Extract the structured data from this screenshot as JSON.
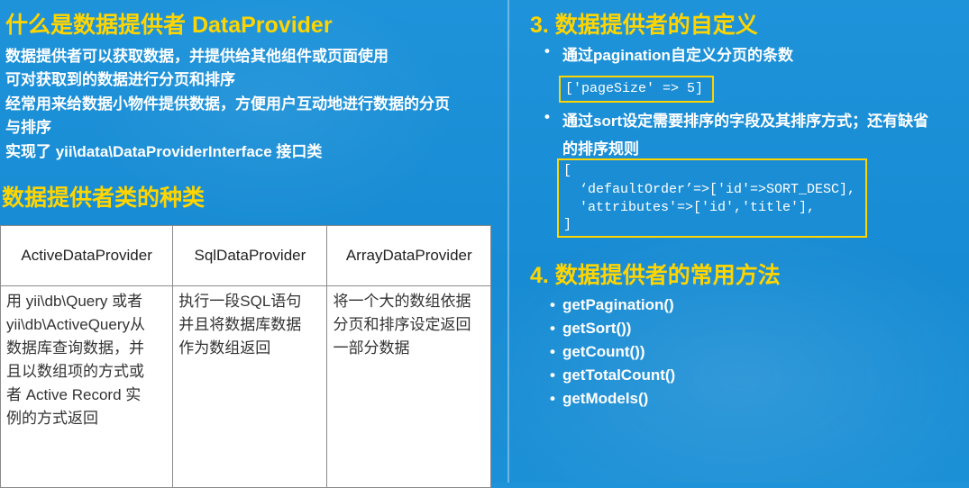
{
  "left": {
    "title": "什么是数据提供者 DataProvider",
    "lines": [
      "数据提供者可以获取数据，并提供给其他组件或页面使用",
      "可对获取到的数据进行分页和排序",
      "经常用来给数据小物件提供数据，方便用户互动地进行数据的分页",
      "与排序",
      "实现了 yii\\data\\DataProviderInterface 接口类"
    ],
    "types_title": "数据提供者类的种类",
    "table": {
      "headers": [
        "ActiveDataProvider",
        "SqlDataProvider",
        "ArrayDataProvider"
      ],
      "col1": [
        "用 yii\\db\\Query 或者",
        "yii\\db\\ActiveQuery从",
        "数据库查询数据，并",
        "且以数组项的方式或",
        "者 Active Record 实",
        "例的方式返回"
      ],
      "col2": [
        "执行一段SQL语句",
        "并且将数据库数据",
        "作为数组返回"
      ],
      "col3": [
        "将一个大的数组依据",
        "分页和排序设定返回",
        "一部分数据"
      ]
    }
  },
  "right": {
    "custom_title": "3. 数据提供者的自定义",
    "bullet1": "通过pagination自定义分页的条数",
    "code1": "['pageSize' => 5]",
    "bullet2_line1": "通过sort设定需要排序的字段及其排序方式；还有缺省",
    "bullet2_line2": "的排序规则",
    "code2": [
      "[",
      "  ‘defaultOrder’=>['id'=>SORT_DESC],",
      "  'attributes'=>['id','title'],",
      "]"
    ],
    "methods_title": "4. 数据提供者的常用方法",
    "methods": [
      "getPagination()",
      "getSort())",
      "getCount())",
      "getTotalCount()",
      "getModels()"
    ],
    "bullet_char": "•"
  }
}
